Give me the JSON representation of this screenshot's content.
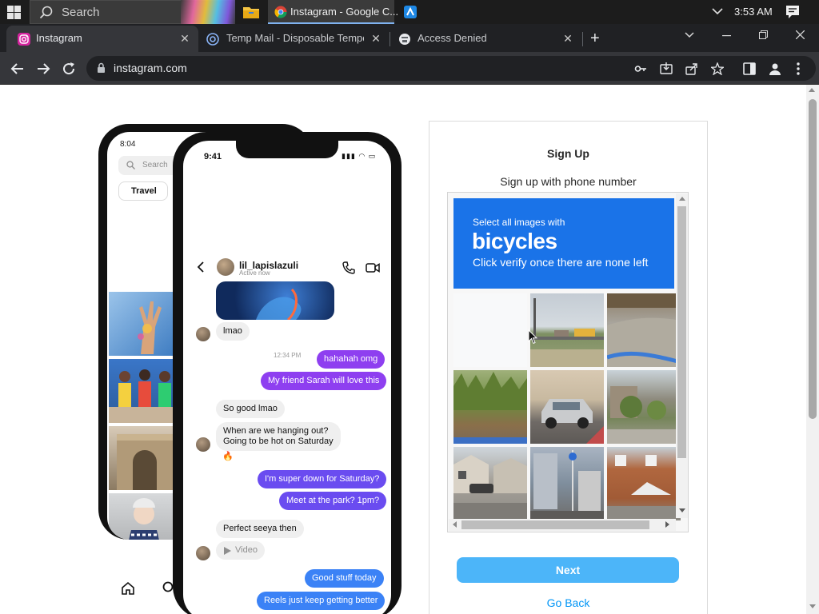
{
  "taskbar": {
    "search_placeholder": "Search",
    "chrome_task_label": "Instagram - Google C...",
    "time": "3:53 AM"
  },
  "browser": {
    "tabs": [
      {
        "title": "Instagram",
        "active": true
      },
      {
        "title": "Temp Mail - Disposable Tempora",
        "active": false
      },
      {
        "title": "Access Denied",
        "active": false
      }
    ],
    "url": "instagram.com"
  },
  "phones": {
    "back": {
      "time": "8:04",
      "search_placeholder": "Search",
      "chip": "Travel"
    },
    "front": {
      "time": "9:41",
      "username": "lil_lapislazuli",
      "status": "Active now",
      "timestamp": "12:34 PM",
      "messages": [
        {
          "text": "lmao",
          "direction": "in"
        },
        {
          "text": "hahahah omg",
          "direction": "out"
        },
        {
          "text": "My friend Sarah will love this",
          "direction": "out"
        },
        {
          "text": "So good lmao",
          "direction": "in"
        },
        {
          "text": "When are we hanging out?\nGoing to be hot on Saturday",
          "direction": "in"
        },
        {
          "text": "🔥",
          "direction": "in"
        },
        {
          "text": "I'm super down for Saturday?",
          "direction": "out"
        },
        {
          "text": "Meet at the park? 1pm?",
          "direction": "out"
        },
        {
          "text": "Perfect seeya then",
          "direction": "in"
        },
        {
          "text": "Video",
          "direction": "in"
        },
        {
          "text": "Good stuff today",
          "direction": "out"
        },
        {
          "text": "Reels just keep getting better",
          "direction": "out"
        }
      ]
    }
  },
  "signup": {
    "title": "Sign Up",
    "subtitle": "Sign up with phone number",
    "captcha": {
      "instruction": "Select all images with",
      "target": "bicycles",
      "hint": "Click verify once there are none left",
      "tiles": [
        "blank",
        "road-fence-truck",
        "curb-corner",
        "grass-roadside",
        "silver-car",
        "street-trees",
        "houses-street",
        "street-signpost",
        "brick-building"
      ]
    },
    "next_label": "Next",
    "go_back_label": "Go Back"
  },
  "colors": {
    "captcha_blue": "#1a73e8",
    "next_button": "#4cb5f9",
    "link_blue": "#0095f6",
    "bubble_purple": "#7b3fe4",
    "bubble_blue": "#3b82f6"
  }
}
